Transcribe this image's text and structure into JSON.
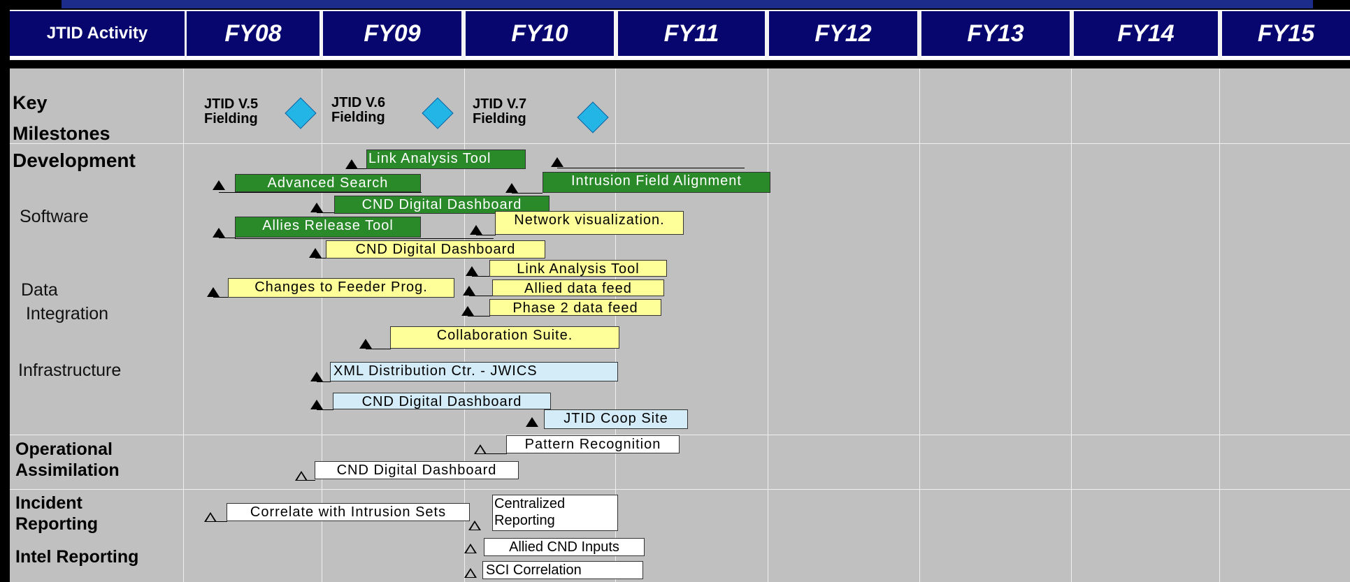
{
  "header": {
    "activity_label": "JTID Activity",
    "fiscal_years": [
      "FY08",
      "FY09",
      "FY10",
      "FY11",
      "FY12",
      "FY13",
      "FY14",
      "FY15"
    ]
  },
  "rows": {
    "key_milestones": "Key\nMilestones",
    "development": "Development",
    "software": "Software",
    "data_integration": "Data\n Integration",
    "infrastructure": "Infrastructure",
    "operational_assimilation": "Operational\nAssimilation",
    "incident_reporting": "Incident\nReporting",
    "intel_reporting": "Intel Reporting"
  },
  "milestones": [
    {
      "label": "JTID V.5\nFielding",
      "diamond_color": "#23b5e6"
    },
    {
      "label": "JTID V.6\nFielding",
      "diamond_color": "#23b5e6"
    },
    {
      "label": "JTID V.7\nFielding",
      "diamond_color": "#23b5e6"
    }
  ],
  "tasks": {
    "link_analysis_tool_dev": "Link Analysis Tool",
    "advanced_search": "Advanced Search",
    "intrusion_field_alignment": "Intrusion Field Alignment",
    "cnd_dashboard_dev": "CND Digital Dashboard",
    "allies_release_tool": "Allies Release  Tool",
    "network_visualization": "Network visualization.",
    "cnd_dashboard_data": "CND Digital Dashboard",
    "link_analysis_tool_data": "Link Analysis Tool",
    "changes_feeder": "Changes to Feeder Prog.",
    "allied_data_feed": "Allied data feed",
    "phase2_data_feed": "Phase 2 data feed",
    "collaboration_suite": "Collaboration  Suite.",
    "xml_distribution": "XML Distribution Ctr. - JWICS",
    "cnd_dashboard_infra": "CND Digital Dashboard",
    "jtid_coop_site": "JTID Coop Site",
    "pattern_recognition": "Pattern Recognition",
    "cnd_dashboard_ops": "CND Digital Dashboard",
    "correlate_intrusion": "Correlate with Intrusion Sets",
    "centralized_reporting": "Centralized\nReporting",
    "allied_cnd_inputs": "Allied CND Inputs",
    "sci_correlation": "SCI Correlation"
  },
  "colors": {
    "header_navy": "#06066e",
    "top_bar": "#1c2c8a",
    "grid_gray": "#c0c0c0",
    "dev_green": "#2a8a2a",
    "data_yellow": "#ffff99",
    "infra_blue": "#d4ecf8",
    "ops_white": "#ffffff",
    "milestone_cyan": "#23b5e6"
  }
}
